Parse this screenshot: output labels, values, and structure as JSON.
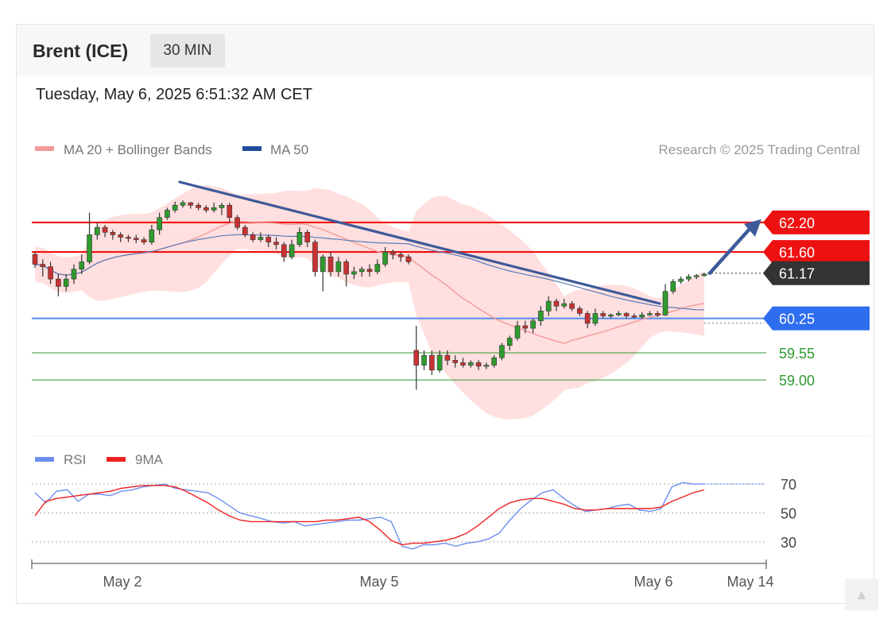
{
  "header": {
    "instrument": "Brent (ICE)",
    "timeframe": "30 MIN",
    "datetime": "Tuesday, May 6, 2025 6:51:32 AM CET"
  },
  "legend": {
    "ma20_label": "MA 20 + Bollinger Bands",
    "ma50_label": "MA 50",
    "copyright": "Research © 2025 Trading Central"
  },
  "colors": {
    "resistance": "#ee1111",
    "support": "#5c8fef",
    "target": "#2f9a2f",
    "current": "#333333",
    "bands": "#ffd4d4",
    "ma20": "#f29a9a",
    "ma50": "#5b7cb8",
    "trendline": "#3d5a99",
    "candle_up": "#2e9b2e",
    "candle_down": "#c83232",
    "rsi": "#6d8ef0",
    "rsi_ma": "#ee2222"
  },
  "chart_data": [
    {
      "type": "candlestick",
      "x_ticks": [
        "May 2",
        "May 5",
        "May 6",
        "May 14"
      ],
      "ylim": [
        58.0,
        63.2
      ],
      "levels": [
        {
          "label": "62.20",
          "value": 62.2,
          "kind": "resistance"
        },
        {
          "label": "61.60",
          "value": 61.6,
          "kind": "resistance"
        },
        {
          "label": "61.17",
          "value": 61.17,
          "kind": "current"
        },
        {
          "label": "60.25",
          "value": 60.25,
          "kind": "support"
        },
        {
          "label": "59.55",
          "value": 59.55,
          "kind": "target"
        },
        {
          "label": "59.00",
          "value": 59.0,
          "kind": "target"
        }
      ],
      "series": [
        {
          "name": "MA 20 + Bollinger Bands"
        },
        {
          "name": "MA 50"
        }
      ],
      "candles": [
        [
          61.55,
          61.35,
          61.6,
          61.28
        ],
        [
          61.35,
          61.3,
          61.45,
          61.1
        ],
        [
          61.3,
          61.05,
          61.4,
          60.95
        ],
        [
          61.05,
          60.9,
          61.15,
          60.7
        ],
        [
          60.9,
          61.05,
          61.15,
          60.8
        ],
        [
          61.05,
          61.25,
          61.35,
          60.95
        ],
        [
          61.25,
          61.4,
          61.55,
          61.15
        ],
        [
          61.4,
          61.95,
          62.4,
          61.35
        ],
        [
          61.95,
          62.1,
          62.2,
          61.85
        ],
        [
          62.1,
          62.0,
          62.15,
          61.9
        ],
        [
          62.0,
          61.95,
          62.05,
          61.85
        ],
        [
          61.95,
          61.9,
          62.0,
          61.8
        ],
        [
          61.9,
          61.88,
          61.95,
          61.8
        ],
        [
          61.88,
          61.85,
          61.95,
          61.78
        ],
        [
          61.85,
          61.8,
          61.9,
          61.75
        ],
        [
          61.8,
          62.05,
          62.15,
          61.75
        ],
        [
          62.05,
          62.3,
          62.4,
          61.95
        ],
        [
          62.3,
          62.45,
          62.5,
          62.25
        ],
        [
          62.45,
          62.55,
          62.62,
          62.4
        ],
        [
          62.55,
          62.6,
          62.65,
          62.5
        ],
        [
          62.6,
          62.55,
          62.62,
          62.48
        ],
        [
          62.55,
          62.5,
          62.6,
          62.45
        ],
        [
          62.5,
          62.45,
          62.55,
          62.4
        ],
        [
          62.45,
          62.5,
          62.6,
          62.4
        ],
        [
          62.5,
          62.55,
          62.6,
          62.35
        ],
        [
          62.55,
          62.3,
          62.6,
          62.2
        ],
        [
          62.3,
          62.1,
          62.35,
          62.05
        ],
        [
          62.1,
          61.95,
          62.15,
          61.9
        ],
        [
          61.95,
          61.85,
          62.0,
          61.8
        ],
        [
          61.85,
          61.9,
          62.0,
          61.8
        ],
        [
          61.9,
          61.8,
          61.95,
          61.7
        ],
        [
          61.8,
          61.75,
          61.9,
          61.65
        ],
        [
          61.75,
          61.5,
          61.8,
          61.4
        ],
        [
          61.5,
          61.75,
          61.85,
          61.45
        ],
        [
          61.75,
          62.0,
          62.1,
          61.7
        ],
        [
          62.0,
          61.8,
          62.05,
          61.7
        ],
        [
          61.8,
          61.2,
          61.85,
          61.1
        ],
        [
          61.2,
          61.5,
          61.55,
          60.8
        ],
        [
          61.5,
          61.2,
          61.6,
          61.1
        ],
        [
          61.2,
          61.4,
          61.5,
          61.1
        ],
        [
          61.4,
          61.15,
          61.45,
          60.9
        ],
        [
          61.15,
          61.2,
          61.3,
          61.05
        ],
        [
          61.2,
          61.25,
          61.3,
          61.1
        ],
        [
          61.25,
          61.2,
          61.35,
          61.1
        ],
        [
          61.2,
          61.35,
          61.45,
          61.15
        ],
        [
          61.35,
          61.6,
          61.7,
          61.3
        ],
        [
          61.6,
          61.55,
          61.65,
          61.45
        ],
        [
          61.55,
          61.5,
          61.6,
          61.4
        ],
        [
          61.5,
          61.4,
          61.55,
          61.35
        ],
        [
          59.6,
          59.3,
          60.1,
          58.8
        ],
        [
          59.3,
          59.5,
          59.6,
          59.2
        ],
        [
          59.5,
          59.2,
          59.6,
          59.1
        ],
        [
          59.2,
          59.5,
          59.6,
          59.15
        ],
        [
          59.5,
          59.4,
          59.6,
          59.3
        ],
        [
          59.4,
          59.35,
          59.5,
          59.25
        ],
        [
          59.35,
          59.3,
          59.45,
          59.25
        ],
        [
          59.3,
          59.35,
          59.4,
          59.25
        ],
        [
          59.35,
          59.28,
          59.4,
          59.2
        ],
        [
          59.28,
          59.3,
          59.35,
          59.22
        ],
        [
          59.3,
          59.45,
          59.5,
          59.25
        ],
        [
          59.45,
          59.7,
          59.75,
          59.4
        ],
        [
          59.7,
          59.85,
          59.9,
          59.6
        ],
        [
          59.85,
          60.1,
          60.2,
          59.8
        ],
        [
          60.1,
          60.05,
          60.2,
          59.95
        ],
        [
          60.05,
          60.2,
          60.25,
          59.95
        ],
        [
          60.2,
          60.4,
          60.5,
          60.1
        ],
        [
          60.4,
          60.6,
          60.7,
          60.3
        ],
        [
          60.6,
          60.5,
          60.65,
          60.4
        ],
        [
          60.5,
          60.55,
          60.65,
          60.45
        ],
        [
          60.55,
          60.45,
          60.6,
          60.4
        ],
        [
          60.45,
          60.35,
          60.5,
          60.3
        ],
        [
          60.35,
          60.15,
          60.4,
          60.05
        ],
        [
          60.15,
          60.35,
          60.45,
          60.1
        ],
        [
          60.35,
          60.3,
          60.4,
          60.25
        ],
        [
          60.3,
          60.32,
          60.35,
          60.25
        ],
        [
          60.32,
          60.35,
          60.4,
          60.3
        ],
        [
          60.35,
          60.3,
          60.38,
          60.25
        ],
        [
          60.3,
          60.28,
          60.35,
          60.25
        ],
        [
          60.28,
          60.32,
          60.38,
          60.25
        ],
        [
          60.32,
          60.35,
          60.4,
          60.3
        ],
        [
          60.35,
          60.32,
          60.4,
          60.28
        ],
        [
          60.32,
          60.8,
          60.95,
          60.3
        ],
        [
          60.8,
          61.0,
          61.05,
          60.75
        ],
        [
          61.0,
          61.05,
          61.1,
          60.95
        ],
        [
          61.05,
          61.1,
          61.15,
          61.0
        ],
        [
          61.1,
          61.12,
          61.15,
          61.05
        ],
        [
          61.12,
          61.15,
          61.18,
          61.1
        ]
      ],
      "projection": {
        "from": 61.17,
        "to": 62.2
      }
    },
    {
      "type": "line",
      "series": [
        {
          "name": "RSI",
          "values": [
            64,
            57,
            65,
            66,
            58,
            63,
            63,
            62,
            65,
            66,
            68,
            69,
            70,
            67,
            66,
            65,
            64,
            60,
            55,
            50,
            48,
            46,
            44,
            43,
            44,
            41,
            42,
            43,
            44,
            45,
            45,
            46,
            47,
            44,
            27,
            25,
            28,
            28,
            29,
            27,
            29,
            30,
            32,
            36,
            45,
            53,
            59,
            64,
            66,
            60,
            55,
            51,
            52,
            53,
            55,
            56,
            52,
            51,
            53,
            68,
            71,
            70,
            70
          ]
        },
        {
          "name": "9MA",
          "values": [
            48,
            58,
            60,
            61,
            62,
            63,
            64,
            65,
            67,
            68,
            69,
            69,
            69,
            68,
            65,
            61,
            57,
            52,
            48,
            45,
            44,
            44,
            44,
            44,
            44,
            44,
            44,
            45,
            45,
            46,
            47,
            44,
            38,
            31,
            28,
            29,
            29,
            30,
            31,
            33,
            36,
            41,
            47,
            53,
            57,
            59,
            60,
            60,
            58,
            56,
            53,
            52,
            52,
            53,
            53,
            53,
            53,
            53,
            54,
            58,
            61,
            64,
            66
          ]
        }
      ],
      "ylim": [
        20,
        75
      ],
      "levels": [
        70,
        50,
        30
      ]
    }
  ],
  "ui": {
    "scroll_icon": "chevron-up-icon"
  }
}
